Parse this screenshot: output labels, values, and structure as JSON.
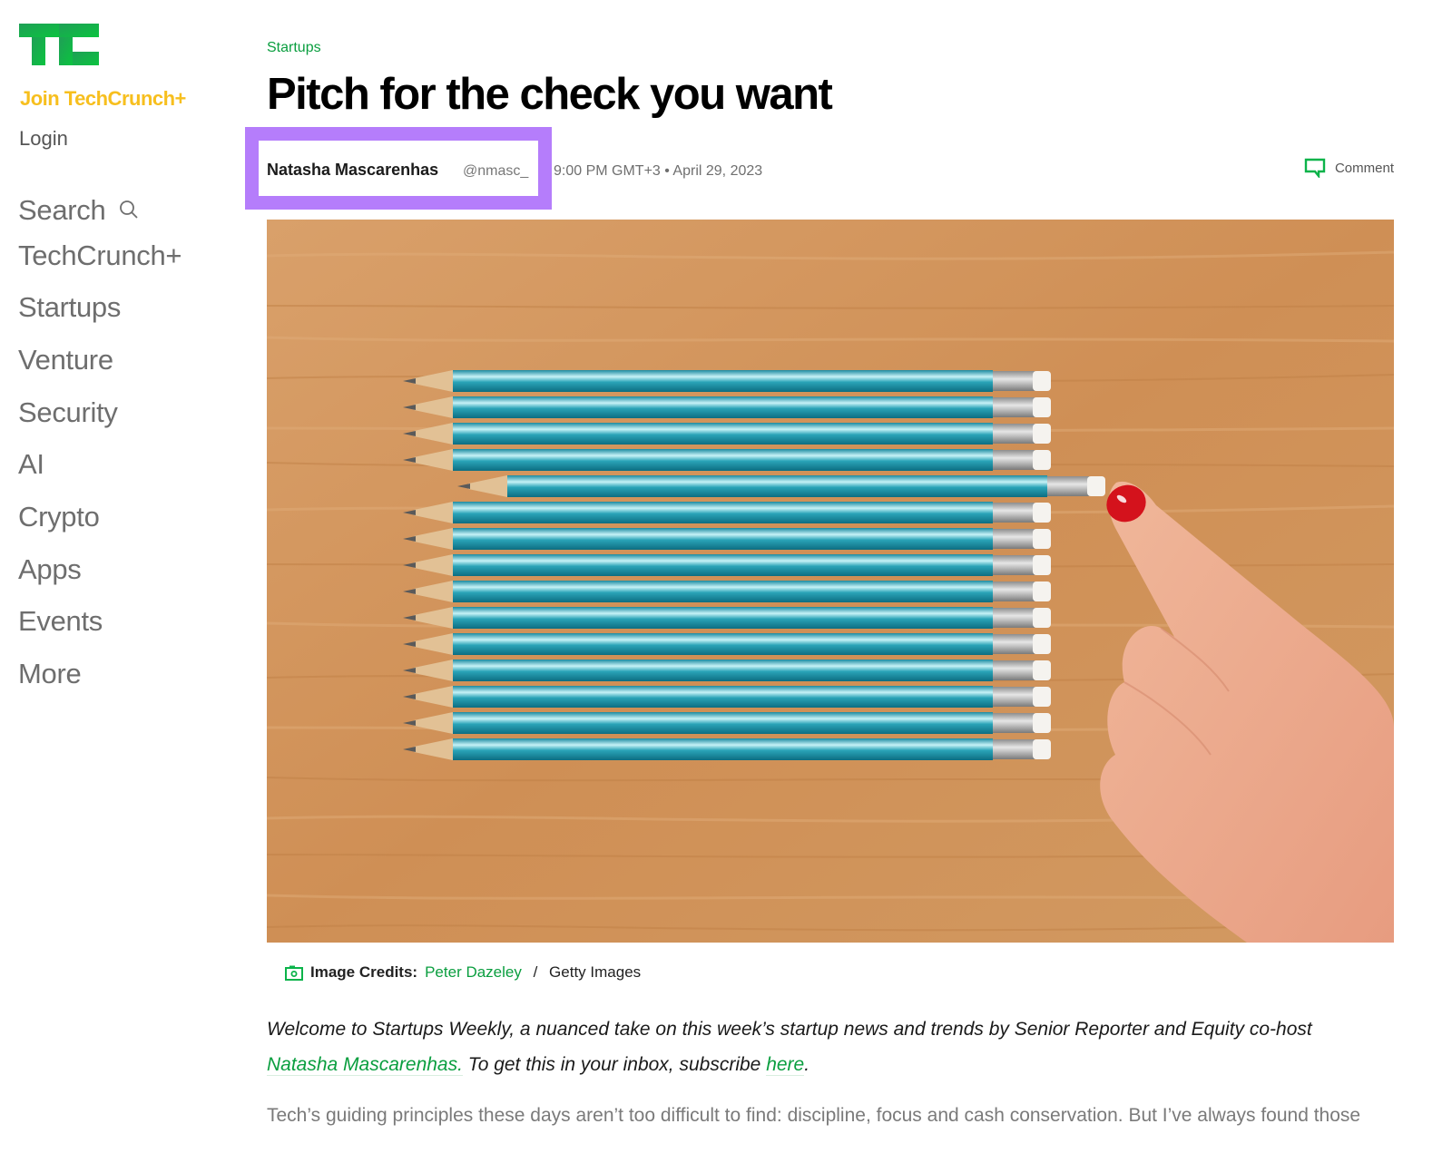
{
  "sidebar": {
    "logo_icon": "techcrunch-logo",
    "join_label": "Join TechCrunch+",
    "login_label": "Login",
    "nav": [
      {
        "label": "Search",
        "icon": "search-icon"
      },
      {
        "label": "TechCrunch+"
      },
      {
        "label": "Startups"
      },
      {
        "label": "Venture"
      },
      {
        "label": "Security"
      },
      {
        "label": "AI"
      },
      {
        "label": "Crypto"
      },
      {
        "label": "Apps"
      },
      {
        "label": "Events"
      },
      {
        "label": "More"
      }
    ]
  },
  "article": {
    "category": "Startups",
    "title": "Pitch for the check you want",
    "author": "Natasha Mascarenhas",
    "handle": "@nmasc_",
    "datetime": "9:00 PM GMT+3 • April 29, 2023",
    "comment_label": "Comment",
    "comment_icon": "comment-icon",
    "image_alt": "Row of teal pencils on wooden table with a finger pushing one pencil out of line",
    "credits": {
      "icon": "camera-icon",
      "label": "Image Credits:",
      "photographer": "Peter Dazeley",
      "separator": " / ",
      "agency": "Getty Images"
    },
    "intro": {
      "part1": "Welcome to Startups Weekly, a nuanced take on this week’s startup news and trends by Senior Reporter and Equity co-host ",
      "author_link": "Natasha Mascarenhas.",
      "part2": " To get this in your inbox, subscribe ",
      "subscribe_link": "here",
      "part3": "."
    },
    "body_first_line": "Tech’s guiding principles these days aren’t too difficult to find: discipline, focus and cash conservation. But I’ve always found those"
  },
  "colors": {
    "brand_green": "#0a9e3f",
    "join_yellow": "#f7bf1e",
    "highlight_purple": "#b57dfb"
  }
}
